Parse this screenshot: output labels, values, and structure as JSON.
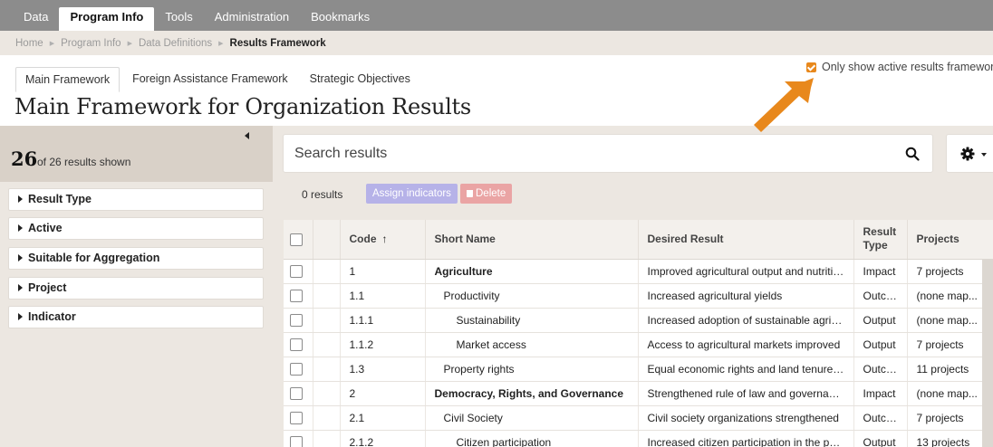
{
  "nav": {
    "items": [
      "Data",
      "Program Info",
      "Tools",
      "Administration",
      "Bookmarks"
    ],
    "active": "Program Info"
  },
  "breadcrumb": [
    "Home",
    "Program Info",
    "Data Definitions",
    "Results Framework"
  ],
  "tabs": [
    "Main Framework",
    "Foreign Assistance Framework",
    "Strategic Objectives"
  ],
  "active_filter": {
    "label": "Only show active results framework",
    "checked": true
  },
  "page_title": "Main Framework for Organization Results",
  "sidebar": {
    "count": "26",
    "count_text": "of 26 results shown",
    "facets": [
      "Result Type",
      "Active",
      "Suitable for Aggregation",
      "Project",
      "Indicator"
    ]
  },
  "search": {
    "placeholder": "Search results"
  },
  "results_bar": {
    "count": "0 results",
    "assign_label": "Assign indicators",
    "delete_label": "Delete"
  },
  "table": {
    "columns": [
      "Code",
      "Short Name",
      "Desired Result",
      "Result Type",
      "Projects"
    ],
    "sort_indicator": "↑",
    "rows": [
      {
        "code": "1",
        "short_name": "Agriculture",
        "level": 1,
        "desired_result": "Improved agricultural output and nutrition",
        "result_type": "Impact",
        "projects": "7 projects"
      },
      {
        "code": "1.1",
        "short_name": "Productivity",
        "level": 2,
        "desired_result": "Increased agricultural yields",
        "result_type": "Outcome",
        "projects": "(none map..."
      },
      {
        "code": "1.1.1",
        "short_name": "Sustainability",
        "level": 3,
        "desired_result": "Increased adoption of sustainable agricult...",
        "result_type": "Output",
        "projects": "(none map..."
      },
      {
        "code": "1.1.2",
        "short_name": "Market access",
        "level": 3,
        "desired_result": "Access to agricultural markets improved",
        "result_type": "Output",
        "projects": "7 projects"
      },
      {
        "code": "1.3",
        "short_name": "Property rights",
        "level": 2,
        "desired_result": "Equal economic rights and land tenure for...",
        "result_type": "Outcome",
        "projects": "11 projects"
      },
      {
        "code": "2",
        "short_name": "Democracy, Rights, and Governance",
        "level": 1,
        "desired_result": "Strengthened rule of law and governance",
        "result_type": "Impact",
        "projects": "(none map..."
      },
      {
        "code": "2.1",
        "short_name": "Civil Society",
        "level": 2,
        "desired_result": "Civil society organizations strengthened",
        "result_type": "Outcome",
        "projects": "7 projects"
      },
      {
        "code": "2.1.2",
        "short_name": "Citizen participation",
        "level": 3,
        "desired_result": "Increased citizen participation in the publi...",
        "result_type": "Output",
        "projects": "13 projects"
      }
    ]
  },
  "colors": {
    "accent_orange": "#e8881c",
    "nav_bg": "#8c8c8c",
    "panel_bg": "#ece7e1"
  }
}
